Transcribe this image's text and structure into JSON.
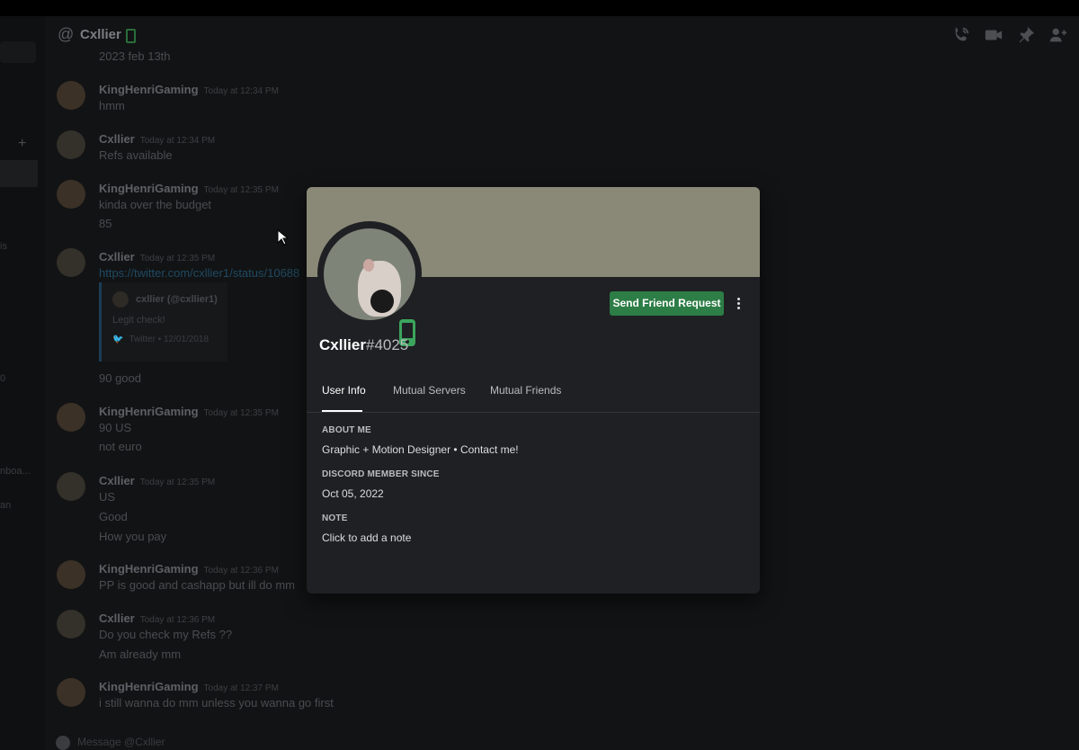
{
  "header": {
    "channel_name": "Cxllier",
    "icons": [
      "phone-call-icon",
      "video-icon",
      "pin-icon",
      "add-friend-icon"
    ]
  },
  "background": {
    "date_fragment": "2023 feb 13th",
    "messages": [
      {
        "author": "KingHenriGaming",
        "time": "Today at 12:34 PM",
        "lines": [
          "hmm"
        ]
      },
      {
        "author": "Cxllier",
        "time": "Today at 12:34 PM",
        "lines": [
          "Refs available"
        ]
      },
      {
        "author": "KingHenriGaming",
        "time": "Today at 12:35 PM",
        "lines": [
          "kinda over the budget",
          "85"
        ]
      },
      {
        "author": "Cxllier",
        "time": "Today at 12:35 PM",
        "lines": [
          "https://twitter.com/cxllier1/status/10688"
        ],
        "after": "90 good"
      },
      {
        "author": "KingHenriGaming",
        "time": "Today at 12:35 PM",
        "lines": [
          "90 US",
          "not euro"
        ]
      },
      {
        "author": "Cxllier",
        "time": "Today at 12:35 PM",
        "lines": [
          "US",
          "Good",
          "How you pay"
        ]
      },
      {
        "author": "KingHenriGaming",
        "time": "Today at 12:36 PM",
        "lines": [
          "PP is good and cashapp but ill do mm"
        ]
      },
      {
        "author": "Cxllier",
        "time": "Today at 12:36 PM",
        "lines": [
          "Do you check my Refs ??",
          "Am already mm"
        ]
      },
      {
        "author": "KingHenriGaming",
        "time": "Today at 12:37 PM",
        "lines": [
          "i still wanna do mm unless you wanna go first"
        ]
      }
    ],
    "embed": {
      "author": "cxllier (@cxllier1)",
      "text": "Legit check!",
      "footer": "Twitter • 12/01/2018"
    },
    "composer_placeholder": "Message @Cxllier",
    "sidebar_fragments": [
      "is",
      "0",
      "nboa...",
      "an"
    ]
  },
  "profile": {
    "username": "Cxllier",
    "discriminator": "#4025",
    "send_button": "Send Friend Request",
    "banner_color": "#8a8877",
    "accent_color": "#2d7d46",
    "tabs": [
      {
        "label": "User Info",
        "active": true
      },
      {
        "label": "Mutual Servers",
        "active": false
      },
      {
        "label": "Mutual Friends",
        "active": false
      }
    ],
    "about_heading": "ABOUT ME",
    "about_text": "Graphic + Motion Designer • Contact me!",
    "member_since_heading": "DISCORD MEMBER SINCE",
    "member_since": "Oct 05, 2022",
    "note_heading": "NOTE",
    "note_placeholder": "Click to add a note"
  }
}
